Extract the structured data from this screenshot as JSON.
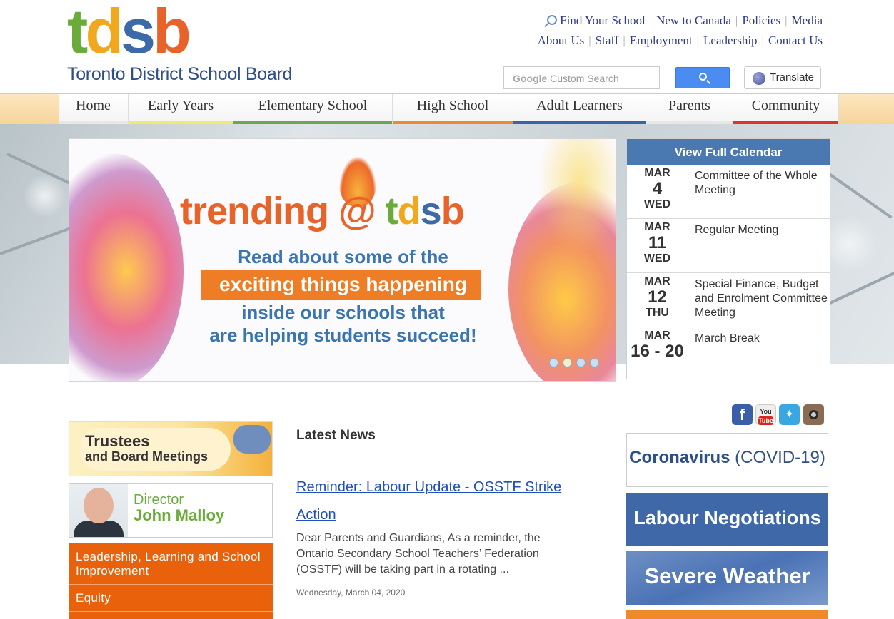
{
  "header": {
    "logo_letters": [
      "t",
      "d",
      "s",
      "b"
    ],
    "board_name": "Toronto District School Board",
    "links_row1": [
      "Find Your School",
      "New to Canada",
      "Policies",
      "Media"
    ],
    "links_row2": [
      "About Us",
      "Staff",
      "Employment",
      "Leadership",
      "Contact Us"
    ],
    "search_brand": "Google",
    "search_placeholder": "Custom Search",
    "translate_label": "Translate"
  },
  "nav": {
    "items": [
      {
        "label": "Home",
        "color": "#e8e8e8"
      },
      {
        "label": "Early Years",
        "color": "#f2ea6e"
      },
      {
        "label": "Elementary School",
        "color": "#6fa552"
      },
      {
        "label": "High School",
        "color": "#ef8a2a"
      },
      {
        "label": "Adult Learners",
        "color": "#3c62a8"
      },
      {
        "label": "Parents",
        "color": "#e8e8e8"
      },
      {
        "label": "Community",
        "color": "#d9362a"
      }
    ]
  },
  "slider": {
    "title_word": "trending",
    "title_at": "@",
    "title_brand": [
      "t",
      "d",
      "s",
      "b"
    ],
    "line1": "Read about some of the",
    "line2": "exciting things happening",
    "line3": "inside our schools that",
    "line4": "are helping students succeed!",
    "slide_count": 4,
    "active_slide": 2
  },
  "calendar": {
    "header": "View Full Calendar",
    "events": [
      {
        "month": "MAR",
        "day": "4",
        "weekday": "WED",
        "title": "Committee of the Whole Meeting"
      },
      {
        "month": "MAR",
        "day": "11",
        "weekday": "WED",
        "title": "Regular Meeting"
      },
      {
        "month": "MAR",
        "day": "12",
        "weekday": "THU",
        "title": "Special Finance, Budget and Enrolment Committee Meeting"
      },
      {
        "month": "MAR",
        "day": "16 - 20",
        "weekday": "",
        "title": "March Break"
      }
    ]
  },
  "left": {
    "trustees_line1": "Trustees",
    "trustees_line2": "and Board Meetings",
    "director_title": "Director",
    "director_name": "John Malloy",
    "links": [
      "Leadership, Learning and School Improvement",
      "Equity",
      ""
    ]
  },
  "news": {
    "heading": "Latest News",
    "headline": "Reminder: Labour Update - OSSTF Strike Action",
    "body": "Dear Parents and Guardians,   As a reminder, the Ontario Secondary School Teachers’ Federation (OSSTF) will be taking part in a rotating ...",
    "date": "Wednesday, March 04, 2020"
  },
  "right": {
    "social": [
      "facebook-icon",
      "youtube-icon",
      "twitter-icon",
      "instagram-icon"
    ],
    "youtube_text": [
      "You",
      "Tube"
    ],
    "covid_bold": "Coronavirus",
    "covid_rest": " (COVID-19)",
    "labour": "Labour Negotiations",
    "weather": "Severe Weather"
  }
}
